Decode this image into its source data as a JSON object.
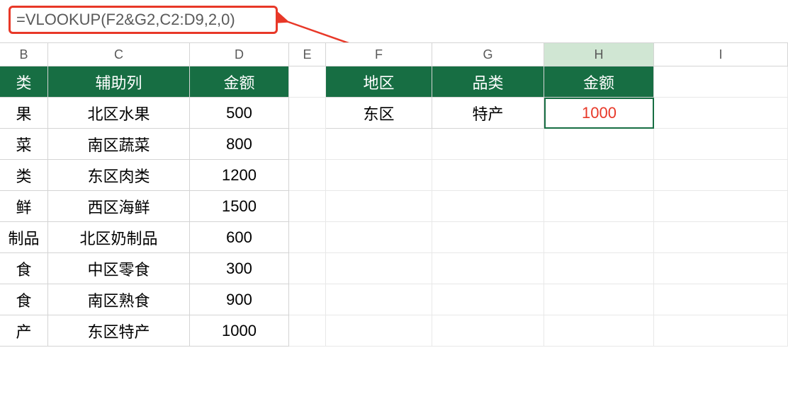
{
  "formula": "=VLOOKUP(F2&G2,C2:D9,2,0)",
  "columns": [
    "B",
    "C",
    "D",
    "E",
    "F",
    "G",
    "H",
    "I"
  ],
  "active_column": "H",
  "left_table": {
    "headers": {
      "b": "类",
      "c": "辅助列",
      "d": "金额"
    },
    "rows": [
      {
        "b": "果",
        "c": "北区水果",
        "d": "500"
      },
      {
        "b": "菜",
        "c": "南区蔬菜",
        "d": "800"
      },
      {
        "b": "类",
        "c": "东区肉类",
        "d": "1200"
      },
      {
        "b": "鲜",
        "c": "西区海鲜",
        "d": "1500"
      },
      {
        "b": "制品",
        "c": "北区奶制品",
        "d": "600"
      },
      {
        "b": "食",
        "c": "中区零食",
        "d": "300"
      },
      {
        "b": "食",
        "c": "南区熟食",
        "d": "900"
      },
      {
        "b": "产",
        "c": "东区特产",
        "d": "1000"
      }
    ]
  },
  "right_table": {
    "headers": {
      "f": "地区",
      "g": "品类",
      "h": "金额"
    },
    "rows": [
      {
        "f": "东区",
        "g": "特产",
        "h": "1000"
      }
    ]
  }
}
